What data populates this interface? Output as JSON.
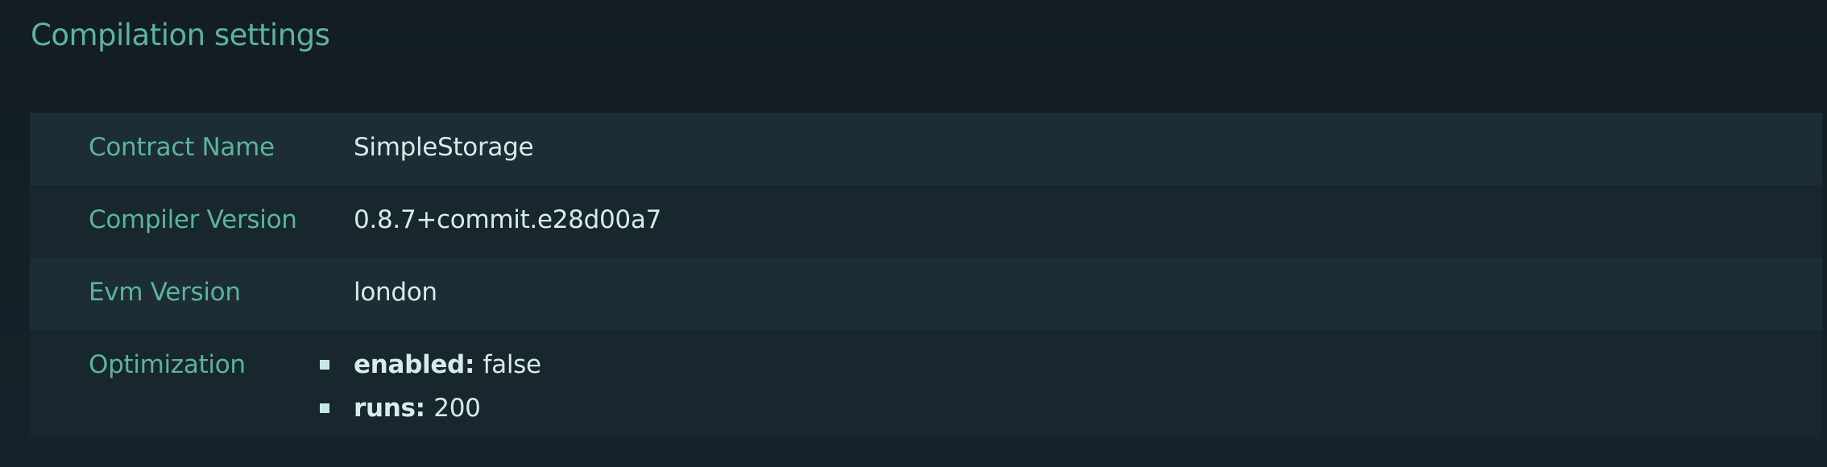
{
  "section": {
    "title": "Compilation settings"
  },
  "settings": {
    "contract_name": {
      "label": "Contract Name",
      "value": "SimpleStorage"
    },
    "compiler_version": {
      "label": "Compiler Version",
      "value": "0.8.7+commit.e28d00a7"
    },
    "evm_version": {
      "label": "Evm Version",
      "value": "london"
    },
    "optimization": {
      "label": "Optimization",
      "items": [
        {
          "key": "enabled:",
          "value": "false"
        },
        {
          "key": "runs:",
          "value": "200"
        }
      ]
    }
  },
  "colors": {
    "background": "#141e23",
    "accent": "#5bb49a",
    "text": "#d6ecea",
    "row_odd": "#1c2d35",
    "row_even": "#18262d"
  }
}
